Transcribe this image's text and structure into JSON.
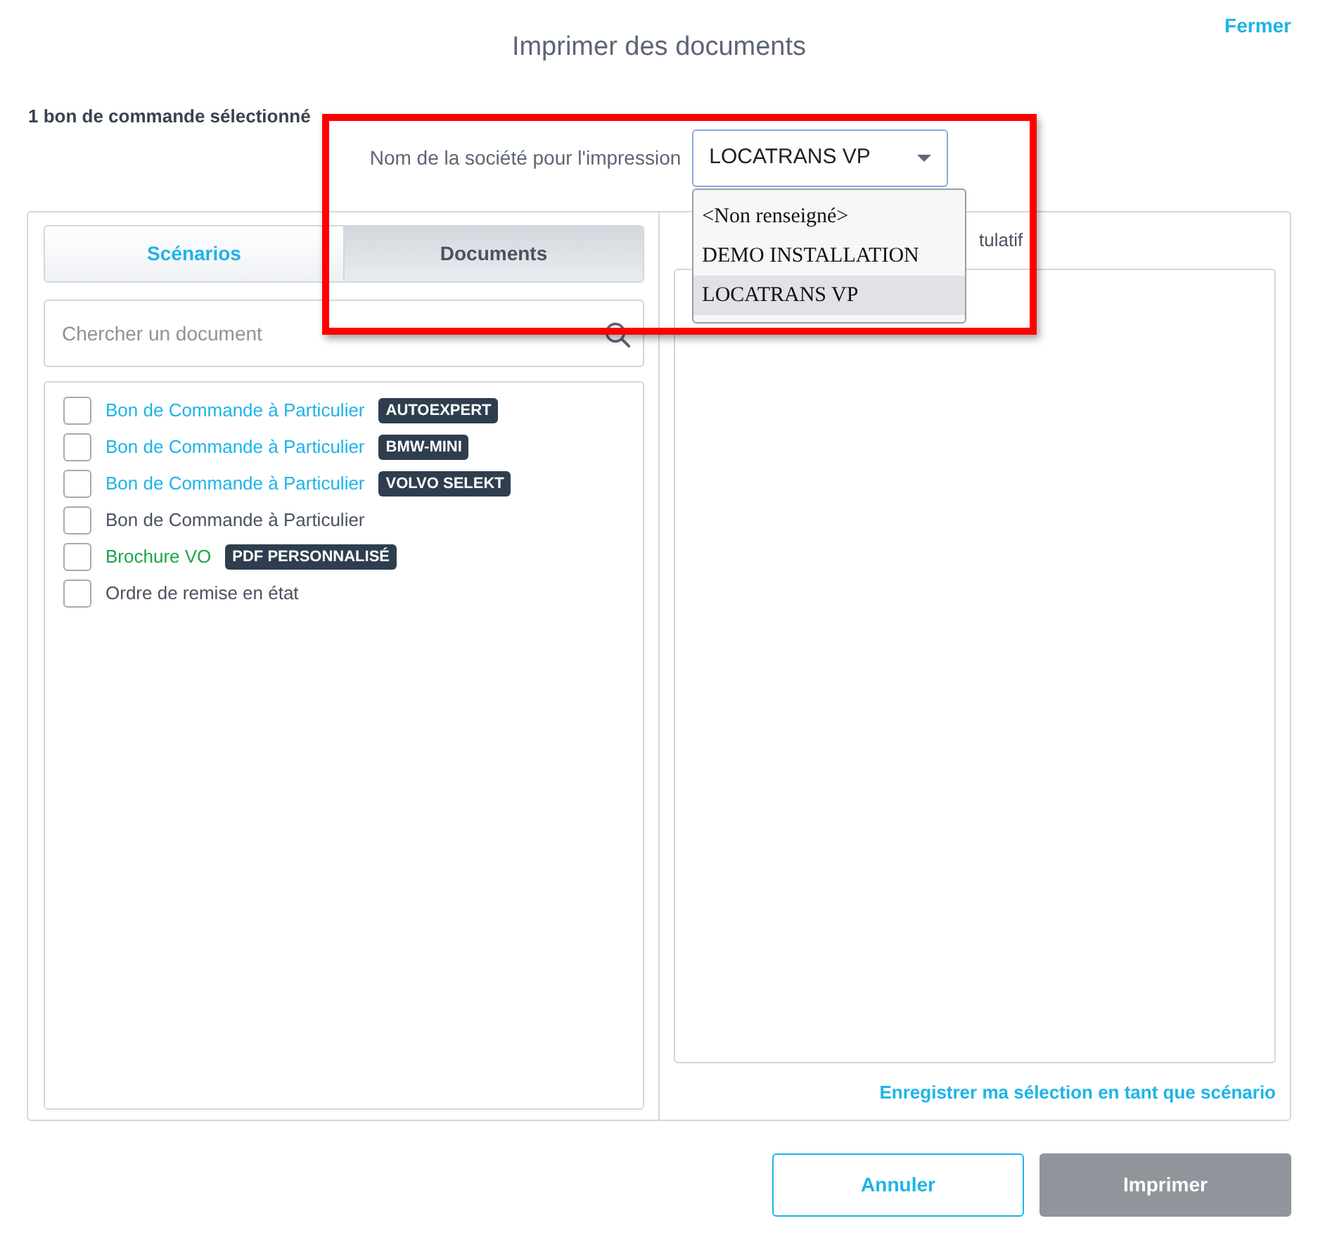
{
  "dialog": {
    "title": "Imprimer des documents",
    "close_link": "Fermer"
  },
  "selection_count": "1 bon de commande sélectionné",
  "company_select": {
    "label": "Nom de la société pour l'impression",
    "value": "LOCATRANS VP",
    "expanded": true,
    "options": [
      {
        "label": "<Non renseigné>",
        "selected": false
      },
      {
        "label": "DEMO INSTALLATION",
        "selected": false
      },
      {
        "label": "LOCATRANS VP",
        "selected": true
      }
    ]
  },
  "tabs": [
    {
      "label": "Scénarios",
      "selected": false
    },
    {
      "label": "Documents",
      "selected": true
    }
  ],
  "search": {
    "placeholder": "Chercher un document"
  },
  "documents": [
    {
      "label": "Bon de Commande à Particulier",
      "color": "#1db4e8",
      "tag": "AUTOEXPERT",
      "checked": false
    },
    {
      "label": "Bon de Commande à Particulier",
      "color": "#1db4e8",
      "tag": "BMW-MINI",
      "checked": false
    },
    {
      "label": "Bon de Commande à Particulier",
      "color": "#1db4e8",
      "tag": "VOLVO SELEKT",
      "checked": false
    },
    {
      "label": "Bon de Commande à Particulier",
      "color": "#4a5260",
      "checked": false
    },
    {
      "label": "Brochure VO",
      "color": "#1aa64a",
      "tag": "PDF PERSONNALISÉ",
      "checked": false
    },
    {
      "label": "Ordre de remise en état",
      "color": "#4a5260",
      "checked": false
    }
  ],
  "selection_panel": {
    "heading": "tulatif",
    "save_link": "Enregistrer ma sélection en tant que scénario"
  },
  "buttons": [
    {
      "label": "Annuler",
      "kind": "outline",
      "disabled": false
    },
    {
      "label": "Imprimer",
      "kind": "primary",
      "disabled": true
    }
  ]
}
